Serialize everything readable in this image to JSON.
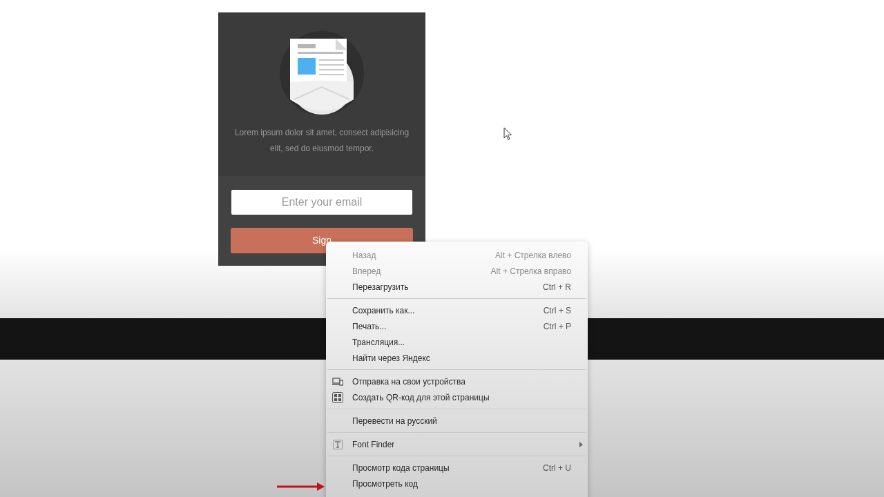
{
  "card": {
    "description": "Lorem ipsum dolor sit amet, consect adipisicing elit, sed do eiusmod tempor.",
    "email": {
      "placeholder": "Enter your email"
    },
    "button": "Sign"
  },
  "context_menu": {
    "groups": [
      [
        {
          "kind": "plain",
          "label": "Назад",
          "shortcut": "Alt + Стрелка влево",
          "disabled": true,
          "submenu": false
        },
        {
          "kind": "plain",
          "label": "Вперед",
          "shortcut": "Alt + Стрелка вправо",
          "disabled": true,
          "submenu": false
        },
        {
          "kind": "plain",
          "label": "Перезагрузить",
          "shortcut": "Ctrl + R",
          "disabled": false,
          "submenu": false
        }
      ],
      [
        {
          "kind": "plain",
          "label": "Сохранить как...",
          "shortcut": "Ctrl + S",
          "disabled": false,
          "submenu": false
        },
        {
          "kind": "plain",
          "label": "Печать...",
          "shortcut": "Ctrl + P",
          "disabled": false,
          "submenu": false
        },
        {
          "kind": "plain",
          "label": "Трансляция...",
          "disabled": false,
          "submenu": false
        },
        {
          "kind": "plain",
          "label": "Найти через Яндекс",
          "disabled": false,
          "submenu": false
        }
      ],
      [
        {
          "kind": "devices",
          "label": "Отправка на свои устройства",
          "disabled": false,
          "submenu": false
        },
        {
          "kind": "qr",
          "label": "Создать QR-код для этой страницы",
          "disabled": false,
          "submenu": false
        }
      ],
      [
        {
          "kind": "plain",
          "label": "Перевести на русский",
          "disabled": false,
          "submenu": false
        }
      ],
      [
        {
          "kind": "extension",
          "label": "Font Finder",
          "disabled": false,
          "submenu": true
        }
      ],
      [
        {
          "kind": "plain",
          "label": "Просмотр кода страницы",
          "shortcut": "Ctrl + U",
          "disabled": false,
          "submenu": false
        },
        {
          "kind": "plain",
          "label": "Просмотреть код",
          "disabled": false,
          "submenu": false
        }
      ]
    ]
  }
}
